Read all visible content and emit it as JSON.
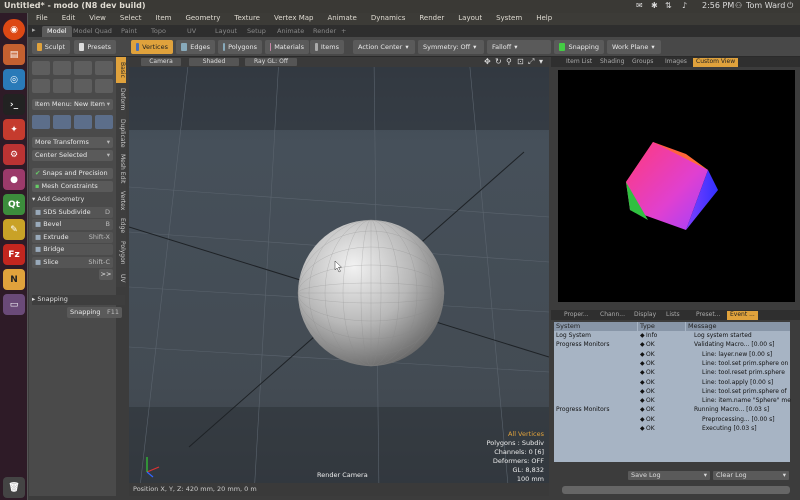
{
  "window": {
    "title": "Untitled* - modo (N8 dev build)",
    "time": "2:56 PM",
    "user": "Tom Ward"
  },
  "menus": [
    "File",
    "Edit",
    "View",
    "Select",
    "Item",
    "Geometry",
    "Texture",
    "Vertex Map",
    "Animate",
    "Dynamics",
    "Render",
    "Layout",
    "System",
    "Help"
  ],
  "tabs": [
    "Model",
    "Model Quad",
    "Paint",
    "Topo",
    "UV",
    "Layout",
    "Setup",
    "Animate",
    "Render",
    "+"
  ],
  "toolbar": {
    "sculpt": "Sculpt",
    "presets": "Presets",
    "vertices": "Vertices",
    "edges": "Edges",
    "polygons": "Polygons",
    "materials": "Materials",
    "items": "Items",
    "action_center": "Action Center",
    "symmetry": "Symmetry: Off",
    "falloff": "Falloff",
    "snapping": "Snapping",
    "work_plane": "Work Plane"
  },
  "leftpanel": {
    "item_menu": "Item Menu: New Item",
    "more_transforms": "More Transforms",
    "center_selected": "Center Selected",
    "snaps": "Snaps and Precision",
    "mesh_constraints": "Mesh Constraints",
    "add_geometry": "Add Geometry",
    "tools": [
      {
        "label": "SDS Subdivide",
        "key": "D"
      },
      {
        "label": "Bevel",
        "key": "B"
      },
      {
        "label": "Extrude",
        "key": "Shift-X"
      },
      {
        "label": "Bridge",
        "key": ""
      },
      {
        "label": "Slice",
        "key": "Shift-C"
      }
    ],
    "more": ">>",
    "snapping_head": "Snapping",
    "snapping_btn": "Snapping",
    "snapping_key": "F11"
  },
  "vtabs": [
    "Basic",
    "Deform",
    "Duplicate",
    "Mesh Edit",
    "Vertex",
    "Edge",
    "Polygon",
    "UV"
  ],
  "viewport": {
    "camera": "Camera",
    "shading": "Shaded",
    "ray": "Ray GL: Off",
    "overlay": [
      "All Vertices",
      "Polygons : Subdiv",
      "Channels: 0 [6]",
      "Deformers: OFF",
      "GL: 8,832",
      "100 mm"
    ],
    "render_camera": "Render Camera",
    "position": "Position X, Y, Z:  420 mm, 20 mm, 0 m"
  },
  "rightview": {
    "tabs": [
      "Item List",
      "Shading",
      "Groups",
      "Images",
      "Custom View"
    ]
  },
  "log": {
    "tabs": [
      "Proper...",
      "Chann...",
      "Display",
      "Lists",
      "Preset...",
      "Event ..."
    ],
    "headers": [
      "System",
      "Type",
      "Message"
    ],
    "rows": [
      {
        "sys": "Log System",
        "type": "Info",
        "msg": "Log system started"
      },
      {
        "sys": "Progress Monitors",
        "type": "OK",
        "msg": "Validating Macro... [0.00 s]"
      },
      {
        "sys": "",
        "type": "OK",
        "msg": "Line: layer.new [0.00 s]"
      },
      {
        "sys": "",
        "type": "OK",
        "msg": "Line: tool.set prim.sphere on"
      },
      {
        "sys": "",
        "type": "OK",
        "msg": "Line: tool.reset prim.sphere"
      },
      {
        "sys": "",
        "type": "OK",
        "msg": "Line: tool.apply [0.00 s]"
      },
      {
        "sys": "",
        "type": "OK",
        "msg": "Line: tool.set prim.sphere of"
      },
      {
        "sys": "",
        "type": "OK",
        "msg": "Line: item.name \"Sphere\" me"
      },
      {
        "sys": "Progress Monitors",
        "type": "OK",
        "msg": "Running Macro... [0.03 s]"
      },
      {
        "sys": "",
        "type": "OK",
        "msg": "Preprocessing... [0.00 s]"
      },
      {
        "sys": "",
        "type": "OK",
        "msg": "Executing [0.03 s]"
      }
    ],
    "save": "Save Log",
    "clear": "Clear Log"
  },
  "colors": {
    "accent": "#e0a23c",
    "panel": "#4a4a4a",
    "log_bg": "#a7b4c4"
  }
}
